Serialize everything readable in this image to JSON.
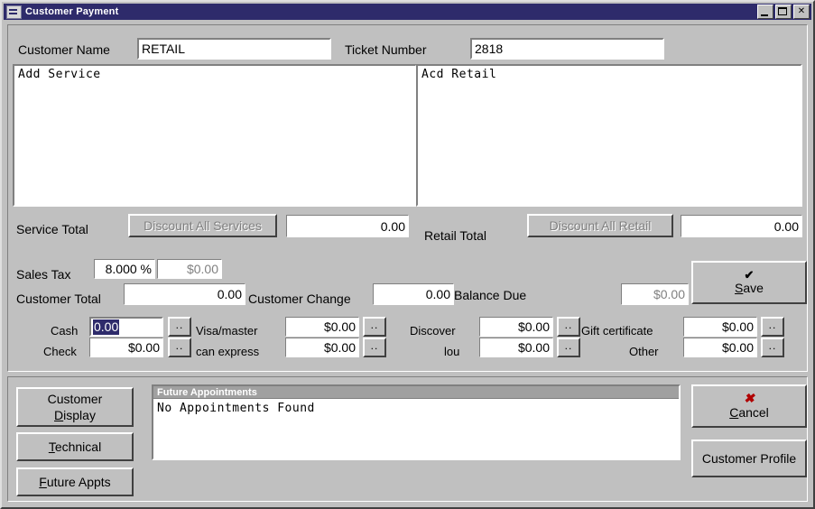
{
  "window": {
    "title": "Customer Payment",
    "icon": "program-icon",
    "buttons": {
      "minimize": "minimize-icon",
      "maximize": "maximize-icon",
      "close": "close-icon"
    }
  },
  "header": {
    "customer_name_label": "Customer Name",
    "customer_name_value": "RETAIL",
    "ticket_number_label": "Ticket Number",
    "ticket_number_value": "2818"
  },
  "service_list": {
    "items": [
      "Add Service"
    ]
  },
  "retail_list": {
    "items": [
      "Acd Retail"
    ]
  },
  "totals": {
    "service_total_label": "Service Total",
    "discount_all_services_label": "Discount All Services",
    "discount_all_services_accel": "S",
    "service_total_value": "0.00",
    "retail_total_label": "Retail Total",
    "discount_all_retail_label": "Discount All Retail",
    "discount_all_retail_accel": "R",
    "retail_total_value": "0.00"
  },
  "tax": {
    "sales_tax_label": "Sales Tax",
    "sales_tax_rate": "8.000 %",
    "sales_tax_amount": "$0.00",
    "customer_total_label": "Customer Total",
    "customer_total_value": "0.00",
    "customer_change_label": "Customer Change",
    "customer_change_value": "0.00",
    "balance_due_label": "Balance Due",
    "balance_due_value": "$0.00"
  },
  "save_button": {
    "icon": "check-icon",
    "accel": "S",
    "rest": "ave"
  },
  "payments": [
    {
      "label": "Cash",
      "value": "0.00",
      "selected": true,
      "dots": ".."
    },
    {
      "label": "Check",
      "value": "$0.00",
      "selected": false,
      "dots": ".."
    },
    {
      "label": "Visa/master",
      "value": "$0.00",
      "selected": false,
      "dots": ".."
    },
    {
      "label": "can express",
      "value": "$0.00",
      "selected": false,
      "dots": ".."
    },
    {
      "label": "Discover",
      "value": "$0.00",
      "selected": false,
      "dots": ".."
    },
    {
      "label": "lou",
      "value": "$0.00",
      "selected": false,
      "dots": ".."
    },
    {
      "label": "Gift certificate",
      "value": "$0.00",
      "selected": false,
      "dots": ".."
    },
    {
      "label": "Other",
      "value": "$0.00",
      "selected": false,
      "dots": ".."
    }
  ],
  "bottom_buttons": {
    "customer_display_line1": "Customer",
    "customer_display_accel": "D",
    "customer_display_rest": "isplay",
    "technical_accel": "T",
    "technical_rest": "echnical",
    "future_appts_accel": "F",
    "future_appts_rest": "uture Appts"
  },
  "appointments": {
    "header": "Future Appointments",
    "body": "No Appointments Found"
  },
  "cancel_button": {
    "icon": "x-icon",
    "accel": "C",
    "rest": "ancel"
  },
  "customer_profile_button": {
    "label": "Customer Profile"
  },
  "colors": {
    "titlebar": "#2e2b6b",
    "face": "#c0c0c0",
    "field_bg": "#ffffff",
    "disabled_text": "#808080",
    "selection": "#2e2b6b",
    "cancel_icon": "#b00000",
    "appt_header_bg": "#a0a0a0"
  }
}
